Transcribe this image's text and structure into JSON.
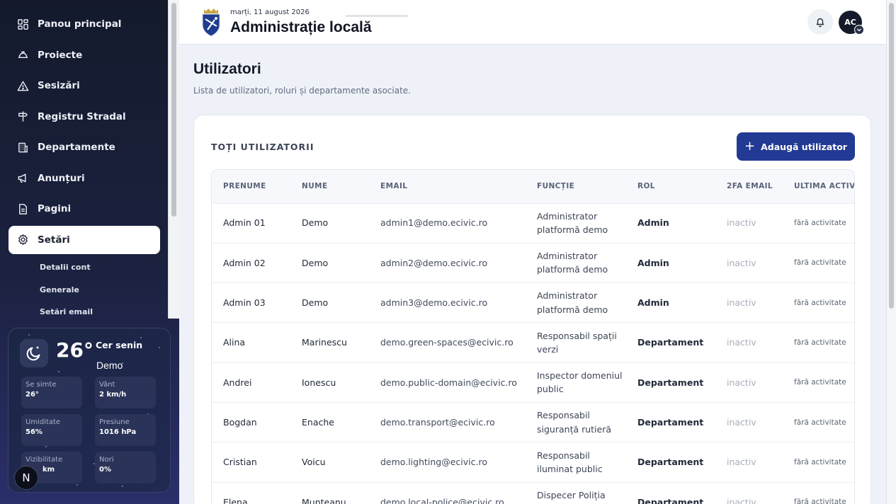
{
  "sidebar": {
    "nav": [
      {
        "label": "Panou principal",
        "icon": "dashboard-icon"
      },
      {
        "label": "Proiecte",
        "icon": "hardhat-icon"
      },
      {
        "label": "Sesizări",
        "icon": "warning-icon"
      },
      {
        "label": "Registru Stradal",
        "icon": "signpost-icon"
      },
      {
        "label": "Departamente",
        "icon": "building-icon"
      },
      {
        "label": "Anunțuri",
        "icon": "megaphone-icon"
      },
      {
        "label": "Pagini",
        "icon": "document-icon"
      },
      {
        "label": "Setări",
        "icon": "gear-icon",
        "active": true
      }
    ],
    "subnav": [
      "Detalii cont",
      "Generale",
      "Setări email"
    ]
  },
  "weather": {
    "temp": "26°",
    "condition": "Cer senin",
    "city": "Demo",
    "stats": [
      {
        "label": "Se simte",
        "value": "26°"
      },
      {
        "label": "Vânt",
        "value": "2 km/h"
      },
      {
        "label": "Umiditate",
        "value": "56%"
      },
      {
        "label": "Presiune",
        "value": "1016 hPa"
      },
      {
        "label": "Vizibilitate",
        "value": "km"
      },
      {
        "label": "Nori",
        "value": "0%"
      }
    ],
    "badge": "N"
  },
  "header": {
    "date": "marți, 11 august 2026",
    "title": "Administrație locală",
    "avatar_initials": "AC"
  },
  "page": {
    "title": "Utilizatori",
    "subtitle": "Lista de utilizatori, roluri și departamente asociate."
  },
  "card": {
    "title": "TOȚI UTILIZATORII",
    "add_button": "Adaugă utilizator"
  },
  "table": {
    "columns": [
      "PRENUME",
      "NUME",
      "EMAIL",
      "FUNCȚIE",
      "ROL",
      "2FA EMAIL",
      "ULTIMA ACTIVITATE"
    ],
    "rows": [
      {
        "prenume": "Admin 01",
        "nume": "Demo",
        "email": "admin1@demo.ecivic.ro",
        "functie": "Administrator platformă demo",
        "rol": "Admin",
        "tfa": "inactiv",
        "last": "fără activitate"
      },
      {
        "prenume": "Admin 02",
        "nume": "Demo",
        "email": "admin2@demo.ecivic.ro",
        "functie": "Administrator platformă demo",
        "rol": "Admin",
        "tfa": "inactiv",
        "last": "fără activitate"
      },
      {
        "prenume": "Admin 03",
        "nume": "Demo",
        "email": "admin3@demo.ecivic.ro",
        "functie": "Administrator platformă demo",
        "rol": "Admin",
        "tfa": "inactiv",
        "last": "fără activitate"
      },
      {
        "prenume": "Alina",
        "nume": "Marinescu",
        "email": "demo.green-spaces@ecivic.ro",
        "functie": "Responsabil spații verzi",
        "rol": "Departament",
        "tfa": "inactiv",
        "last": "fără activitate"
      },
      {
        "prenume": "Andrei",
        "nume": "Ionescu",
        "email": "demo.public-domain@ecivic.ro",
        "functie": "Inspector domeniul public",
        "rol": "Departament",
        "tfa": "inactiv",
        "last": "fără activitate"
      },
      {
        "prenume": "Bogdan",
        "nume": "Enache",
        "email": "demo.transport@ecivic.ro",
        "functie": "Responsabil siguranță rutieră",
        "rol": "Departament",
        "tfa": "inactiv",
        "last": "fără activitate"
      },
      {
        "prenume": "Cristian",
        "nume": "Voicu",
        "email": "demo.lighting@ecivic.ro",
        "functie": "Responsabil iluminat public",
        "rol": "Departament",
        "tfa": "inactiv",
        "last": "fără activitate"
      },
      {
        "prenume": "Elena",
        "nume": "Munteanu",
        "email": "demo.local-police@ecivic.ro",
        "functie": "Dispecer Poliția Locală",
        "rol": "Departament",
        "tfa": "inactiv",
        "last": "fără activitate"
      }
    ]
  }
}
